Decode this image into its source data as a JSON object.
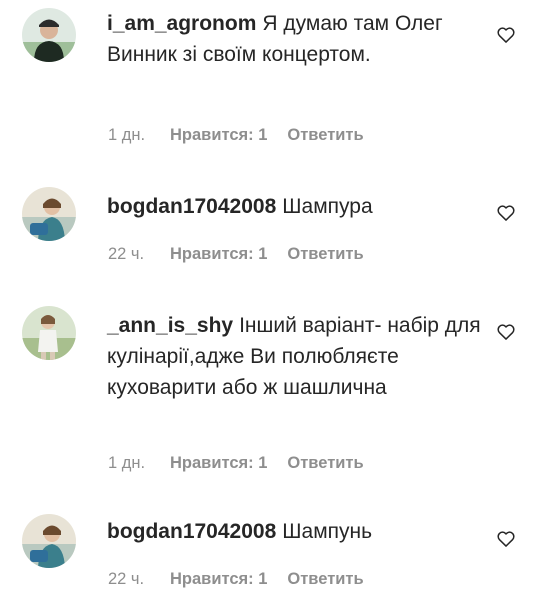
{
  "comments": [
    {
      "username": "i_am_agronom",
      "text": "Я думаю там Олег Винник зі своїм концертом.",
      "time": "1 дн.",
      "likes": "Нравится: 1",
      "reply": "Ответить"
    },
    {
      "username": "bogdan17042008",
      "text": "Шампура",
      "time": "22 ч.",
      "likes": "Нравится: 1",
      "reply": "Ответить"
    },
    {
      "username": "_ann_is_shy",
      "text": "Інший варіант- набір для кулінарії,адже Ви полюбляєте куховарити або ж шашлична",
      "time": "1 дн.",
      "likes": "Нравится: 1",
      "reply": "Ответить"
    },
    {
      "username": "bogdan17042008",
      "text": "Шампунь",
      "time": "22 ч.",
      "likes": "Нравится: 1",
      "reply": "Ответить"
    }
  ],
  "icons": {
    "like": "heart-outline-icon",
    "avatar": "user-avatar"
  },
  "colors": {
    "text": "#262626",
    "secondary": "#8e8e8e"
  }
}
